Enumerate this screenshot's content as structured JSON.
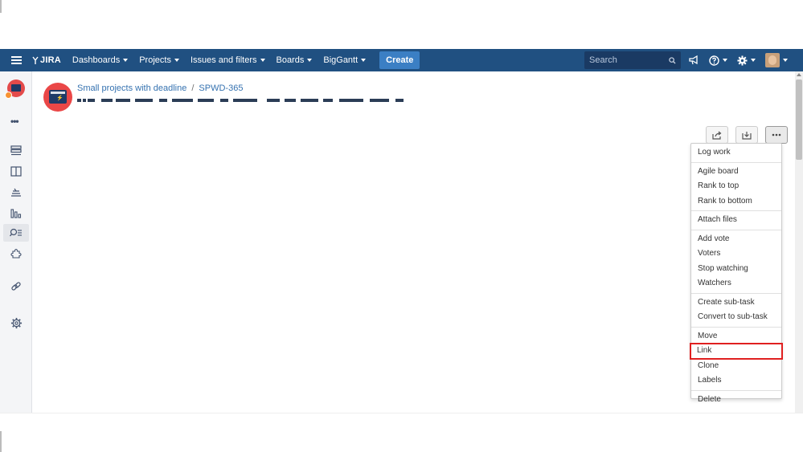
{
  "colors": {
    "navbar": "#205081",
    "create": "#3b7fc4",
    "link_text": "#3572b0",
    "highlight": "#e02020"
  },
  "nav": {
    "logo": "JIRA",
    "items": [
      "Dashboards",
      "Projects",
      "Issues and filters",
      "Boards",
      "BigGantt"
    ],
    "create_label": "Create",
    "search_placeholder": "Search",
    "right_icons": [
      "megaphone-icon",
      "help-icon",
      "settings-icon",
      "user-avatar"
    ]
  },
  "sidebar": {
    "icons": [
      "backlog-icon",
      "board-icon",
      "releases-icon",
      "reports-icon",
      "issues-icon",
      "add-ons-icon",
      "project-shortcut-icon",
      "project-settings-icon"
    ]
  },
  "issue": {
    "project": "Small projects with deadline",
    "key": "SPWD-365"
  },
  "toolbar": {
    "buttons": [
      "share-icon",
      "export-icon",
      "more-icon"
    ]
  },
  "menu": {
    "groups": [
      [
        "Log work"
      ],
      [
        "Agile board",
        "Rank to top",
        "Rank to bottom"
      ],
      [
        "Attach files"
      ],
      [
        "Add vote",
        "Voters",
        "Stop watching",
        "Watchers"
      ],
      [
        "Create sub-task",
        "Convert to sub-task"
      ],
      [
        "Move",
        "Link",
        "Clone",
        "Labels"
      ],
      [
        "Delete"
      ]
    ],
    "highlighted": "Link"
  }
}
